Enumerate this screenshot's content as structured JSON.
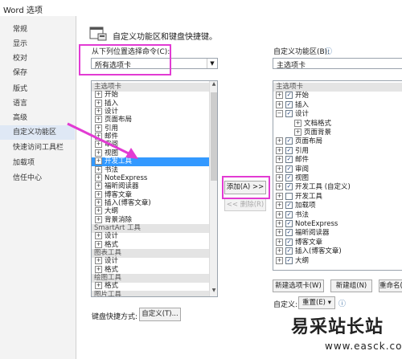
{
  "window": {
    "title": "Word 选项"
  },
  "nav": [
    "常规",
    "显示",
    "校对",
    "保存",
    "版式",
    "语言",
    "高级",
    "自定义功能区",
    "快速访问工具栏",
    "加载项",
    "信任中心"
  ],
  "header": {
    "title": "自定义功能区和键盘快捷键。"
  },
  "left": {
    "choose_label": "从下列位置选择命令(C):",
    "combo_value": "所有选项卡",
    "items": [
      {
        "t": "主选项卡",
        "k": "grp"
      },
      {
        "t": "开始",
        "k": "exp"
      },
      {
        "t": "插入",
        "k": "exp"
      },
      {
        "t": "设计",
        "k": "exp"
      },
      {
        "t": "页面布局",
        "k": "exp"
      },
      {
        "t": "引用",
        "k": "exp"
      },
      {
        "t": "邮件",
        "k": "exp"
      },
      {
        "t": "审阅",
        "k": "exp"
      },
      {
        "t": "视图",
        "k": "exp"
      },
      {
        "t": "开发工具",
        "k": "sel"
      },
      {
        "t": "书法",
        "k": "exp"
      },
      {
        "t": "NoteExpress",
        "k": "exp"
      },
      {
        "t": "福昕阅读器",
        "k": "exp"
      },
      {
        "t": "博客文章",
        "k": "exp"
      },
      {
        "t": "插入(博客文章)",
        "k": "exp"
      },
      {
        "t": "大纲",
        "k": "exp"
      },
      {
        "t": "背景消除",
        "k": "exp"
      },
      {
        "t": "SmartArt 工具",
        "k": "grp"
      },
      {
        "t": "设计",
        "k": "exp"
      },
      {
        "t": "格式",
        "k": "exp"
      },
      {
        "t": "图表工具",
        "k": "grp"
      },
      {
        "t": "设计",
        "k": "exp"
      },
      {
        "t": "格式",
        "k": "exp"
      },
      {
        "t": "绘图工具",
        "k": "grp"
      },
      {
        "t": "格式",
        "k": "exp"
      },
      {
        "t": "图片工具",
        "k": "grp"
      }
    ]
  },
  "middle": {
    "add_label": "添加(A) >>",
    "remove_label": "<< 删除(R)"
  },
  "right": {
    "label": "自定义功能区(B):",
    "combo_value": "主选项卡",
    "items": [
      {
        "t": "主选项卡",
        "k": "grp"
      },
      {
        "t": "开始",
        "k": "chk",
        "c": true
      },
      {
        "t": "插入",
        "k": "chk",
        "c": true
      },
      {
        "t": "设计",
        "k": "chkopen",
        "c": true
      },
      {
        "t": "文档格式",
        "k": "sub"
      },
      {
        "t": "页面背景",
        "k": "sub"
      },
      {
        "t": "页面布局",
        "k": "chk",
        "c": true
      },
      {
        "t": "引用",
        "k": "chk",
        "c": true
      },
      {
        "t": "邮件",
        "k": "chk",
        "c": true
      },
      {
        "t": "审阅",
        "k": "chk",
        "c": true
      },
      {
        "t": "视图",
        "k": "chk",
        "c": true
      },
      {
        "t": "开发工具 (自定义)",
        "k": "chk",
        "c": true
      },
      {
        "t": "开发工具",
        "k": "chk",
        "c": false
      },
      {
        "t": "加载项",
        "k": "chk",
        "c": true
      },
      {
        "t": "书法",
        "k": "chk",
        "c": true
      },
      {
        "t": "NoteExpress",
        "k": "chk",
        "c": true
      },
      {
        "t": "福昕阅读器",
        "k": "chk",
        "c": true
      },
      {
        "t": "博客文章",
        "k": "chk",
        "c": true
      },
      {
        "t": "插入(博客文章)",
        "k": "chk",
        "c": true
      },
      {
        "t": "大纲",
        "k": "chk",
        "c": true
      }
    ],
    "new_tab": "新建选项卡(W)",
    "new_group": "新建组(N)",
    "rename": "重命名(M)...",
    "custom_label": "自定义:",
    "reset": "重置(E) ▾",
    "info": "ⓘ"
  },
  "bottom": {
    "shortcuts_label": "键盘快捷方式:",
    "customize_button": "自定义(T)..."
  },
  "watermark": {
    "main": "易采站长站",
    "url": "www.easck.com"
  },
  "colors": {
    "highlight": "#e23bd3",
    "selection": "#3399ff",
    "nav_active": "#dfe8f5"
  }
}
